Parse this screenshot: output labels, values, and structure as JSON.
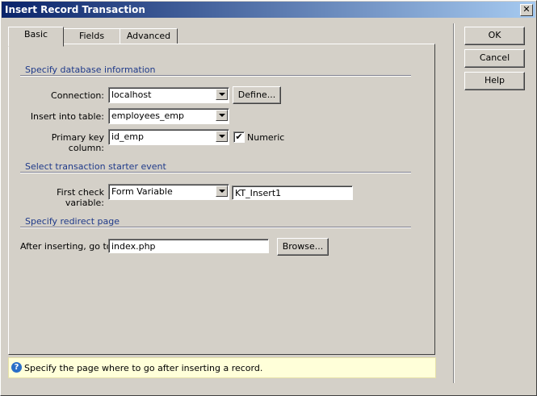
{
  "window": {
    "title": "Insert Record Transaction",
    "close_glyph": "✕"
  },
  "tabs": [
    {
      "label": "Basic",
      "active": true
    },
    {
      "label": "Fields",
      "active": false
    },
    {
      "label": "Advanced",
      "active": false
    }
  ],
  "sections": {
    "database": {
      "heading": "Specify database information",
      "connection": {
        "label": "Connection:",
        "value": "localhost",
        "button": "Define..."
      },
      "insert_table": {
        "label": "Insert into table:",
        "value": "employees_emp"
      },
      "primary_key": {
        "label": "Primary key column:",
        "value": "id_emp",
        "numeric_label": "Numeric",
        "numeric_checked": true
      }
    },
    "starter": {
      "heading": "Select transaction starter event",
      "check_variable": {
        "label": "First check variable:",
        "type_value": "Form Variable",
        "name_value": "KT_Insert1"
      }
    },
    "redirect": {
      "heading": "Specify redirect page",
      "after_insert": {
        "label": "After inserting, go to:",
        "value": "index.php",
        "button": "Browse..."
      }
    }
  },
  "help": {
    "icon": "question-icon",
    "text": "Specify the page where to go after inserting a record."
  },
  "buttons": {
    "ok": "OK",
    "cancel": "Cancel",
    "help": "Help"
  },
  "colors": {
    "title_start": "#0a246a",
    "title_end": "#a6caf0",
    "section": "#1f3a8a",
    "helpbar": "#ffffd9"
  }
}
